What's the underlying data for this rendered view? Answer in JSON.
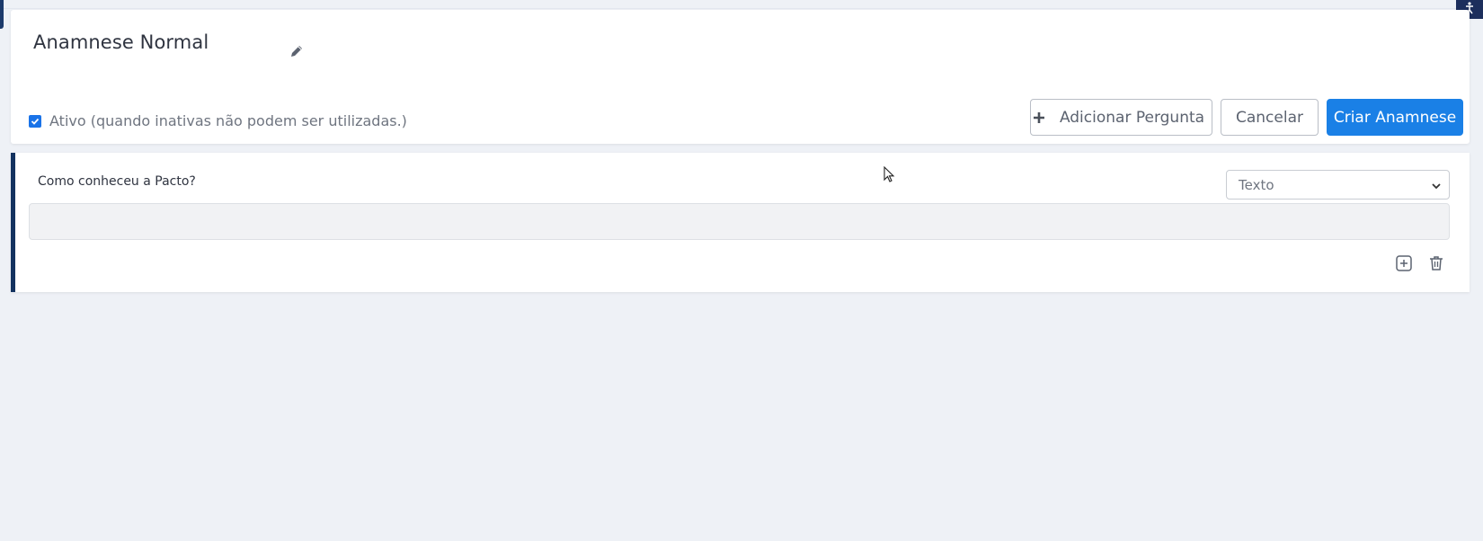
{
  "form": {
    "title": "Anamnese Normal",
    "active_checked": true,
    "active_label": "Ativo (quando inativas não podem ser utilizadas.)"
  },
  "toolbar": {
    "add_question_label": "Adicionar Pergunta",
    "cancel_label": "Cancelar",
    "create_label": "Criar Anamnese"
  },
  "question": {
    "label": "Como conheceu a Pacto?",
    "type_selected": "Texto",
    "answer_value": ""
  },
  "icons": {
    "edit": "pencil-icon",
    "add": "plus-icon",
    "add_question_inline": "plus-square-icon",
    "delete": "trash-icon",
    "dropdown": "chevron-down-icon",
    "corner": "accessibility-icon"
  },
  "colors": {
    "primary": "#1a80e6",
    "question_accent": "#13325f",
    "background": "#eef1f6"
  }
}
